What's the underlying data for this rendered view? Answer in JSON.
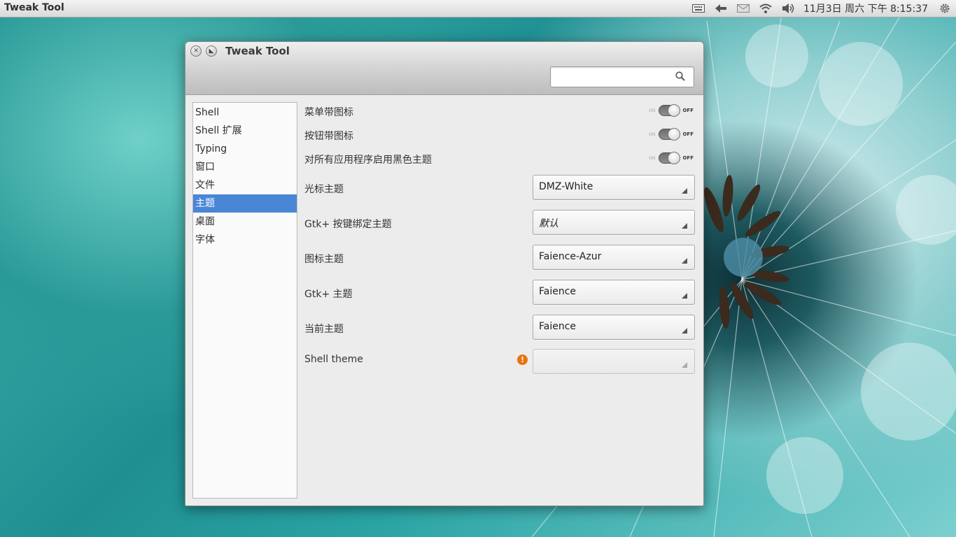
{
  "panel": {
    "app_name": "Tweak Tool",
    "clock": "11月3日 周六  下午 8:15:37",
    "tray_icons": [
      "keyboard-icon",
      "network-arrow-icon",
      "mail-icon",
      "wifi-icon",
      "volume-icon",
      "gear-icon"
    ]
  },
  "window": {
    "title": "Tweak Tool",
    "search": {
      "value": "",
      "placeholder": ""
    }
  },
  "sidebar": {
    "items": [
      {
        "label": "Shell"
      },
      {
        "label": "Shell 扩展"
      },
      {
        "label": "Typing"
      },
      {
        "label": "窗口"
      },
      {
        "label": "文件"
      },
      {
        "label": "主题",
        "selected": true
      },
      {
        "label": "桌面"
      },
      {
        "label": "字体"
      }
    ]
  },
  "settings": {
    "toggles": [
      {
        "label": "菜单带图标",
        "on_text": "ON",
        "off_text": "OFF",
        "state": "off"
      },
      {
        "label": "按钮带图标",
        "on_text": "ON",
        "off_text": "OFF",
        "state": "off"
      },
      {
        "label": "对所有应用程序启用黑色主题",
        "on_text": "ON",
        "off_text": "OFF",
        "state": "off"
      }
    ],
    "combos": [
      {
        "label": "光标主题",
        "value": "DMZ-White"
      },
      {
        "label": "Gtk+ 按键绑定主题",
        "value": "默认"
      },
      {
        "label": "图标主题",
        "value": "Faience-Azur"
      },
      {
        "label": "Gtk+ 主题",
        "value": "Faience"
      },
      {
        "label": "当前主题",
        "value": "Faience"
      },
      {
        "label": "Shell theme",
        "value": "",
        "disabled": true,
        "warning": "!"
      }
    ]
  },
  "colors": {
    "selection": "#4a86d6",
    "warning": "#e8730c"
  }
}
